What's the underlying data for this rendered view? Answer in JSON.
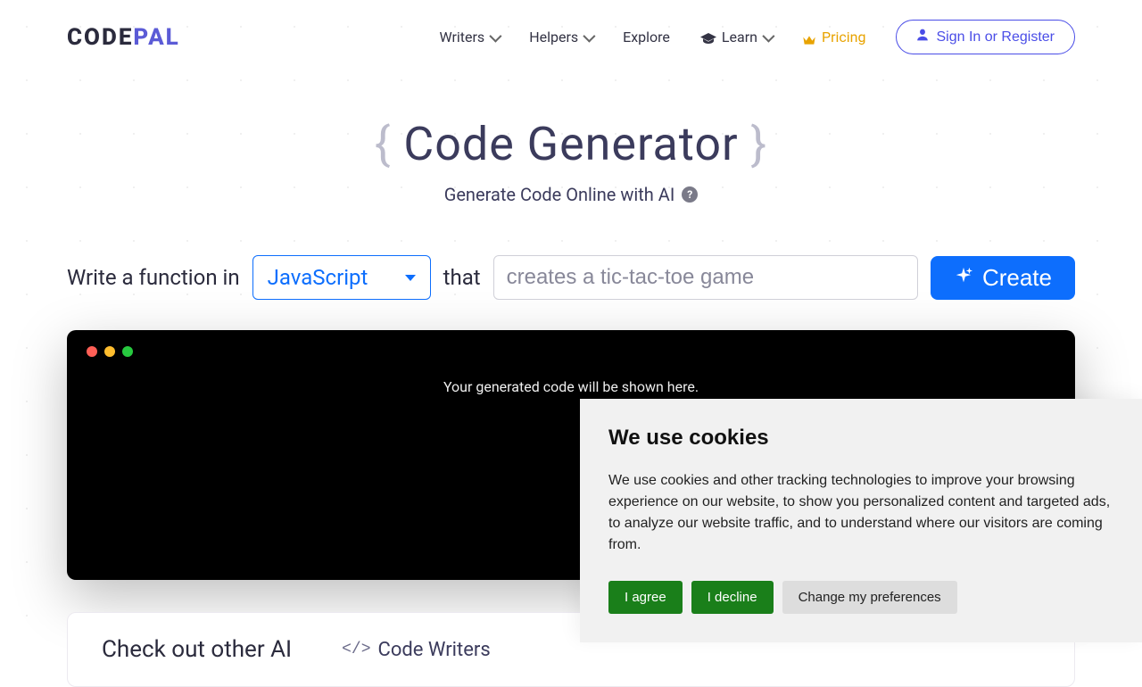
{
  "logo": {
    "part1": "CODE",
    "part2": "PAL"
  },
  "nav": {
    "writers": "Writers",
    "helpers": "Helpers",
    "explore": "Explore",
    "learn": "Learn",
    "pricing": "Pricing",
    "sign_in": "Sign In or Register"
  },
  "hero": {
    "title": "Code Generator",
    "subtitle": "Generate Code Online with AI"
  },
  "form": {
    "prefix": "Write a function in",
    "language": "JavaScript",
    "that": "that",
    "placeholder": "creates a tic-tac-toe game",
    "create": "Create"
  },
  "code_panel": {
    "placeholder": "Your generated code will be shown here."
  },
  "other": {
    "title": "Check out other AI",
    "writers": "Code Writers"
  },
  "cookie": {
    "title": "We use cookies",
    "body": "We use cookies and other tracking technologies to improve your browsing experience on our website, to show you personalized content and targeted ads, to analyze our website traffic, and to understand where our visitors are coming from.",
    "agree": "I agree",
    "decline": "I decline",
    "prefs": "Change my preferences"
  }
}
